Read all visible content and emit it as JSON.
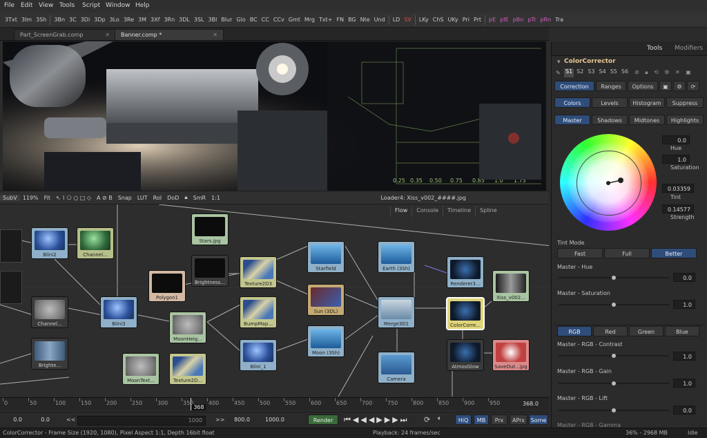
{
  "menu": [
    "File",
    "Edit",
    "View",
    "Tools",
    "Script",
    "Window",
    "Help"
  ],
  "toolbar": [
    "3Txt",
    "3Im",
    "3Sh",
    "3Bn",
    "3C",
    "3Di",
    "3Dp",
    "3Lo",
    "3Re",
    "3M",
    "3Xf",
    "3Rn",
    "3DL",
    "3SL",
    "3Bl",
    "Blur",
    "Glo",
    "BC",
    "CC",
    "CCv",
    "Gmt",
    "Mrg",
    "Txt+",
    "FN",
    "BG",
    "Nte",
    "Und",
    "LD",
    "SV",
    "LKy",
    "ChS",
    "UKy",
    "Pri",
    "Prt",
    "pE",
    "pIE",
    "pBn",
    "pTr",
    "pRn",
    "Tra"
  ],
  "doc_tabs": [
    "Part_ScreenGrab.comp",
    "Banner.comp *"
  ],
  "viewer_bar": {
    "subv": "SubV",
    "zoom": "119%",
    "fit": "Fit",
    "snap": "Snap",
    "lut": "LUT",
    "roi": "RoI",
    "dod": "DoD",
    "smr": "SmR",
    "ratio": "1:1",
    "loader": "Loader4: Xiss_v002_####.jpg"
  },
  "viewer_overlay_ticks": [
    "0.25",
    "0.35",
    "0.50",
    "0.75",
    "0.85",
    "1.0",
    "1.75"
  ],
  "flow_tabs": [
    "Flow",
    "Console",
    "Timeline",
    "Spline"
  ],
  "nodes": [
    {
      "name": "Blini2",
      "color": "#8fb0c8",
      "thumb": "sphere-blue"
    },
    {
      "name": "Channel...",
      "color": "#b6bf8a",
      "thumb": "sphere-green"
    },
    {
      "name": "Stars.jpg",
      "color": "#a9c4a2",
      "thumb": "black"
    },
    {
      "name": "Brightness...",
      "color": "#3a3a3a",
      "thumb": "black"
    },
    {
      "name": "Texture2D3",
      "color": "#c3c68e",
      "thumb": "plane"
    },
    {
      "name": "Polygon1",
      "color": "#d4b8a2",
      "thumb": "black"
    },
    {
      "name": "Starfield",
      "color": "#8fb0c8",
      "thumb": "cubes"
    },
    {
      "name": "Earth (3Sh)",
      "color": "#8fb0c8",
      "thumb": "cubes"
    },
    {
      "name": "Renderer3...",
      "color": "#8fb0c8",
      "thumb": "earth"
    },
    {
      "name": "Xiss_v002...",
      "color": "#a9c4a2",
      "thumb": "station"
    },
    {
      "name": "Channel...",
      "color": "#3a3a3a",
      "thumb": "moon"
    },
    {
      "name": "Blini3",
      "color": "#8fb0c8",
      "thumb": "sphere-blue"
    },
    {
      "name": "MoonHeig...",
      "color": "#a9c4a2",
      "thumb": "moon"
    },
    {
      "name": "BumpMap...",
      "color": "#c3c68e",
      "thumb": "plane"
    },
    {
      "name": "Sun (3DL)",
      "color": "#c4aa72",
      "thumb": "light"
    },
    {
      "name": "Merge3D1",
      "color": "#8fb0c8",
      "thumb": "merge"
    },
    {
      "name": "ColorCorre...",
      "color": "#e0d57a",
      "thumb": "earth"
    },
    {
      "name": "Brighte...",
      "color": "#3a3a3a",
      "thumb": "map"
    },
    {
      "name": "Moon (3Sh)",
      "color": "#8fb0c8",
      "thumb": "cubes"
    },
    {
      "name": "Blini_1",
      "color": "#8fb0c8",
      "thumb": "sphere-blue"
    },
    {
      "name": "MoonText...",
      "color": "#a9c4a2",
      "thumb": "moon"
    },
    {
      "name": "Texture2D...",
      "color": "#c3c68e",
      "thumb": "plane"
    },
    {
      "name": "Camera",
      "color": "#8fb0c8",
      "thumb": "camera"
    },
    {
      "name": "AtmosGlow",
      "color": "#3a3a3a",
      "thumb": "earth"
    },
    {
      "name": "SaveOut...jpg",
      "color": "#d98a8a",
      "thumb": "film"
    }
  ],
  "ruler": {
    "ticks": [
      "0",
      "50",
      "100",
      "150",
      "200",
      "250",
      "300",
      "350",
      "400",
      "450",
      "500",
      "550",
      "600",
      "650",
      "700",
      "750",
      "800",
      "850",
      "900",
      "950"
    ],
    "current": "368",
    "end": "368.0",
    "current_frame_fraction": 0.368
  },
  "transport": {
    "start": "0.0",
    "render_start": "0.0",
    "range_left": "<<",
    "range_value": "1000",
    "range_right": ">>",
    "render_end": "800.0",
    "end": "1000.0",
    "render_button": "Render",
    "hiq": "HiQ",
    "mb": "MB",
    "prx": "Prx",
    "aprx": "APrx",
    "some": "Some"
  },
  "status": {
    "left": "ColorCorrector - Frame Size (1920, 1080), Pixel Aspect 1:1, Depth 16bit float",
    "playback": "Playback: 24 frames/sec",
    "memory": "36% - 2968 MB",
    "state": "Idle"
  },
  "inspector": {
    "tabs": [
      "Tools",
      "Modifiers"
    ],
    "title": "ColorCorrector",
    "slots": [
      "S1",
      "S2",
      "S3",
      "S4",
      "S5",
      "S6"
    ],
    "subtabs": [
      "Correction",
      "Ranges",
      "Options"
    ],
    "modes": [
      "Colors",
      "Levels",
      "Histogram",
      "Suppress"
    ],
    "ranges": [
      "Master",
      "Shadows",
      "Midtones",
      "Highlights"
    ],
    "hue": {
      "value": "0.0",
      "label": "Hue"
    },
    "saturation": {
      "value": "1.0",
      "label": "Saturation"
    },
    "tint": {
      "value": "0.03359",
      "label": "Tint"
    },
    "strength": {
      "value": "0.14577",
      "label": "Strength"
    },
    "tint_mode": {
      "label": "Tint Mode",
      "options": [
        "Fast",
        "Full",
        "Better"
      ],
      "selected": "Better"
    },
    "master_hue": {
      "label": "Master - Hue",
      "value": "0.0",
      "level": 0.5
    },
    "master_sat": {
      "label": "Master - Saturation",
      "value": "1.0",
      "level": 0.5
    },
    "channels": [
      "RGB",
      "Red",
      "Green",
      "Blue"
    ],
    "rgb_contrast": {
      "label": "Master - RGB - Contrast",
      "value": "1.0",
      "level": 0.5
    },
    "rgb_gain": {
      "label": "Master - RGB - Gain",
      "value": "1.0",
      "level": 0.5
    },
    "rgb_lift": {
      "label": "Master - RGB - Lift",
      "value": "0.0",
      "level": 0.5
    },
    "rgb_gamma": {
      "label": "Master - RGB - Gamma"
    }
  },
  "colors": {
    "accent": "#2f4d7a",
    "selected_node": "#e0d57a",
    "render_button": "#3a6a3a"
  }
}
